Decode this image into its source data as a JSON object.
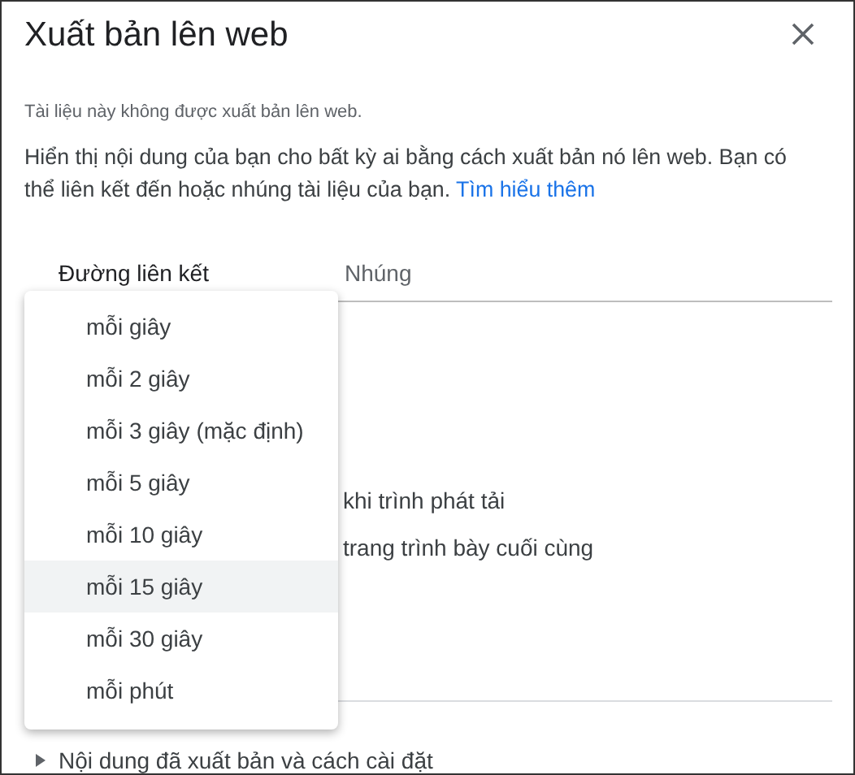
{
  "dialog": {
    "title": "Xuất bản lên web",
    "status": "Tài liệu này không được xuất bản lên web.",
    "description": "Hiển thị nội dung của bạn cho bất kỳ ai bằng cách xuất bản nó lên web. Bạn có thể liên kết đến hoặc nhúng tài liệu của bạn.",
    "learn_more_link": "Tìm hiểu thêm"
  },
  "tabs": [
    {
      "label": "Đường liên kết",
      "selected": true
    },
    {
      "label": "Nhúng",
      "selected": false
    }
  ],
  "options_behind": [
    "khi trình phát tải",
    "trang trình bày cuối cùng"
  ],
  "dropdown_menu": [
    {
      "label": "mỗi giây",
      "selected": false
    },
    {
      "label": "mỗi 2 giây",
      "selected": false
    },
    {
      "label": "mỗi 3 giây (mặc định)",
      "selected": false
    },
    {
      "label": "mỗi 5 giây",
      "selected": false
    },
    {
      "label": "mỗi 10 giây",
      "selected": false
    },
    {
      "label": "mỗi 15 giây",
      "selected": true
    },
    {
      "label": "mỗi 30 giây",
      "selected": false
    },
    {
      "label": "mỗi phút",
      "selected": false
    }
  ],
  "footer": {
    "label": "Nội dung đã xuất bản và cách cài đặt",
    "expanded": false
  }
}
